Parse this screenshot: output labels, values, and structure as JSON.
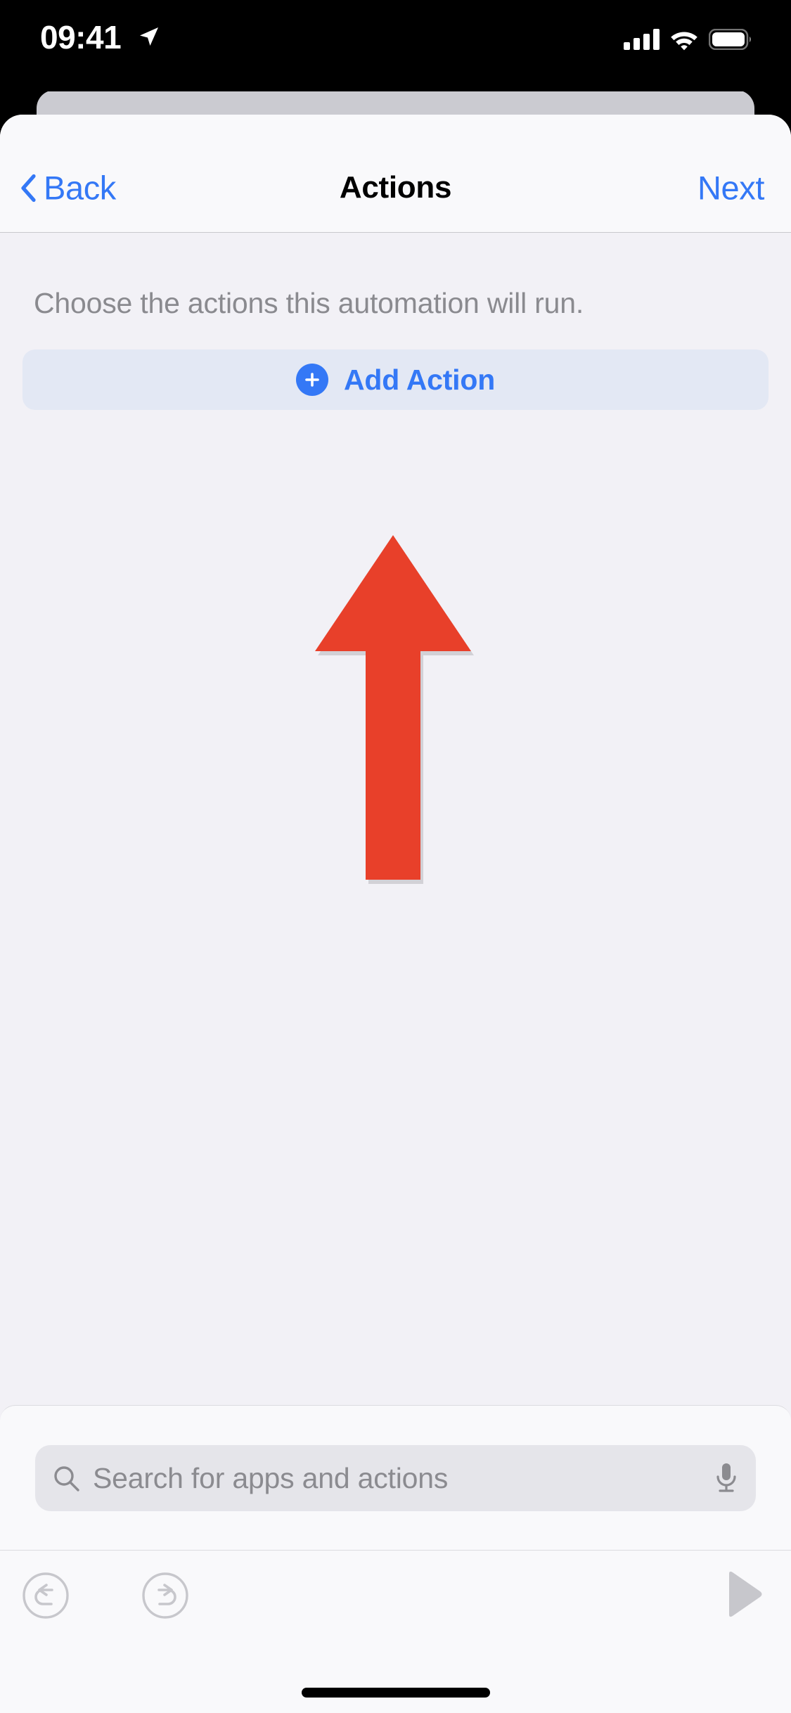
{
  "status_bar": {
    "time": "09:41",
    "location_icon": "location-arrow-icon",
    "cellular_icon": "signal-bars-icon",
    "wifi_icon": "wifi-icon",
    "battery_icon": "battery-icon"
  },
  "nav": {
    "back_label": "Back",
    "back_icon": "chevron-left-icon",
    "title": "Actions",
    "next_label": "Next"
  },
  "content": {
    "subtitle": "Choose the actions this automation will run.",
    "add_action_label": "Add Action",
    "add_action_icon": "plus-circle-icon"
  },
  "annotation": {
    "type": "arrow",
    "direction": "up",
    "points_to": "Add Action",
    "color": "#e8402a"
  },
  "bottom": {
    "search_placeholder": "Search for apps and actions",
    "search_value": "",
    "search_icon": "magnifying-glass-icon",
    "mic_icon": "microphone-icon",
    "undo_icon": "undo-circle-icon",
    "redo_icon": "redo-circle-icon",
    "play_icon": "play-triangle-icon"
  },
  "colors": {
    "accent_blue": "#3478f6",
    "sheet_bg": "#f2f1f6",
    "nav_bg": "#f9f9fb",
    "add_action_bg": "#e3e8f4",
    "search_bg": "#e5e5ea",
    "muted_text": "#8a8a8f",
    "annotation_red": "#e8402a",
    "disabled_gray": "#c7c7cc"
  }
}
